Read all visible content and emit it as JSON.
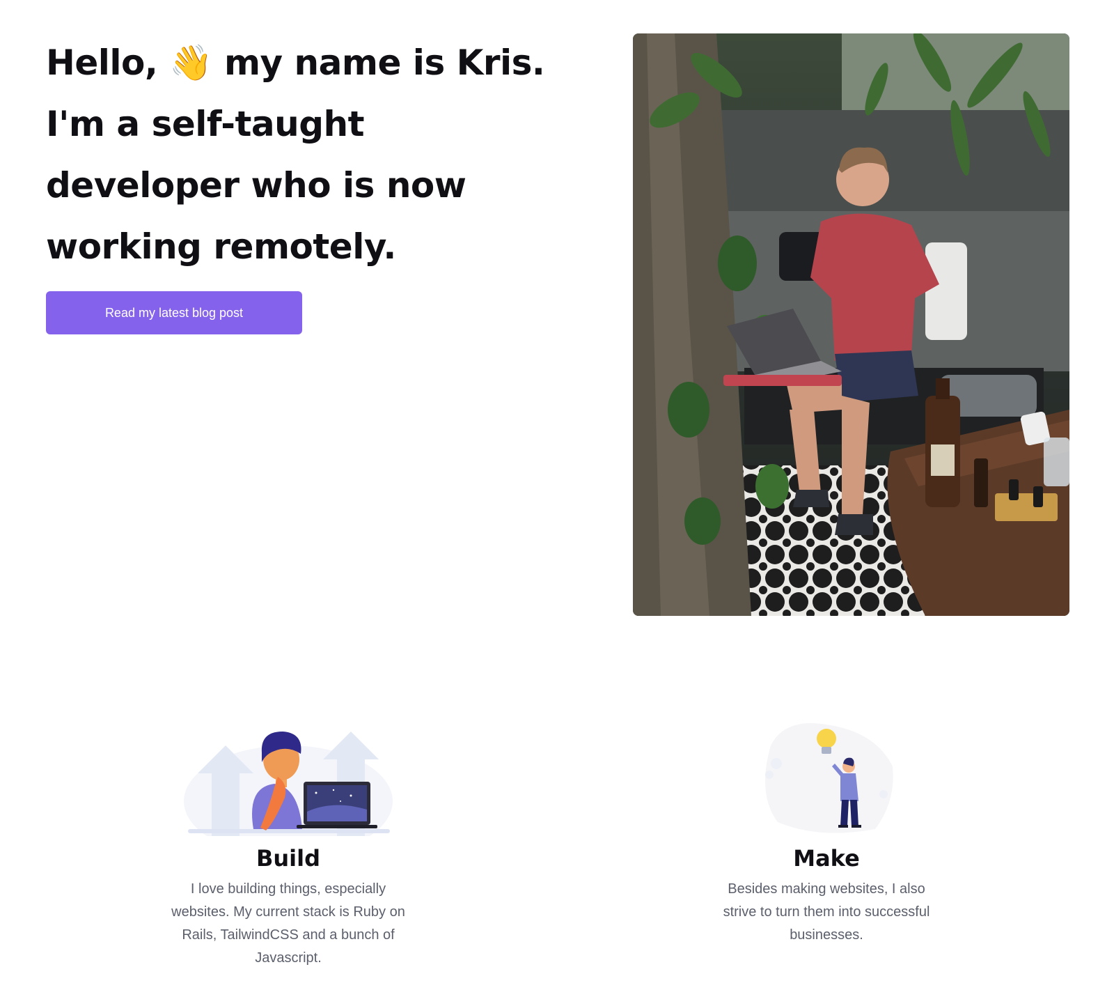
{
  "hero": {
    "line1": "Hello, 👋 my name is Kris.",
    "line2": "I'm a self-taught",
    "line3": "developer who is now",
    "line4": "working remotely.",
    "cta_label": "Read my latest blog post",
    "accent_color": "#8562eb"
  },
  "photo": {
    "icon": "photo-of-developer-working-on-laptop"
  },
  "features": {
    "build": {
      "title": "Build",
      "text": "I love building things, especially websites. My current stack is Ruby on Rails, TailwindCSS and a bunch of Javascript.",
      "icon": "developer-with-laptop-illustration"
    },
    "make": {
      "title": "Make",
      "text": "Besides making websites, I also strive to turn them into successful businesses.",
      "icon": "person-with-lightbulb-illustration"
    }
  }
}
